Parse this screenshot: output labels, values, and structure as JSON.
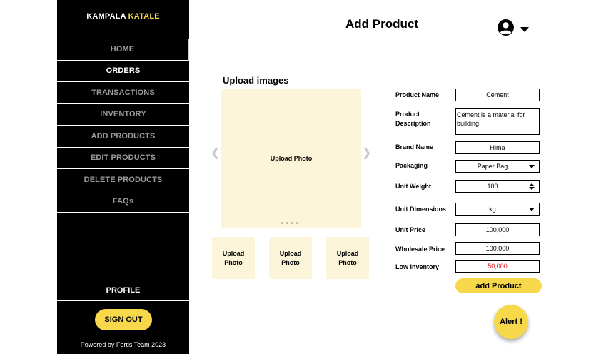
{
  "sidebar": {
    "brand_primary": "KAMPALA",
    "brand_accent": "KATALE",
    "items": [
      {
        "label": "HOME"
      },
      {
        "label": "ORDERS"
      },
      {
        "label": "TRANSACTIONS"
      },
      {
        "label": "INVENTORY"
      },
      {
        "label": "ADD PRODUCTS"
      },
      {
        "label": "EDIT PRODUCTS"
      },
      {
        "label": "DELETE PRODUCTS"
      },
      {
        "label": "FAQs"
      }
    ],
    "profile_label": "PROFILE",
    "signout_label": "SIGN OUT",
    "footer": "Powered by Fortis Team 2023"
  },
  "header": {
    "title": "Add Product",
    "avatar_icon": "user-circle-icon"
  },
  "upload": {
    "heading": "Upload images",
    "main_label": "Upload Photo",
    "thumb_line1": "Upload",
    "thumb_line2": "Photo",
    "prev_icon": "chevron-left-icon",
    "next_icon": "chevron-right-icon"
  },
  "form": {
    "product_name": {
      "label": "Product Name",
      "value": "Cement"
    },
    "product_description": {
      "label_line1": "Product",
      "label_line2": "Description",
      "value": "Cement is a material for building"
    },
    "brand_name": {
      "label": "Brand Name",
      "value": "Hima"
    },
    "packaging": {
      "label": "Packaging",
      "value": "Paper Bag"
    },
    "unit_weight": {
      "label": "Unit Weight",
      "value": "100"
    },
    "unit_dimensions": {
      "label": "Unit Dimensions",
      "value": "kg"
    },
    "unit_price": {
      "label": "Unit Price",
      "value": "100,000"
    },
    "wholesale_price": {
      "label": "Wholesale Price",
      "value": "100,000"
    },
    "low_inventory": {
      "label": "Low Inventory",
      "value": "50,000"
    },
    "submit_label": "add Product"
  },
  "alert_label": "Alert !",
  "colors": {
    "accent": "#f7d84a",
    "sidebar_bg": "#000000",
    "photo_bg": "#fcf5d9",
    "warning_text": "#e0161b"
  }
}
